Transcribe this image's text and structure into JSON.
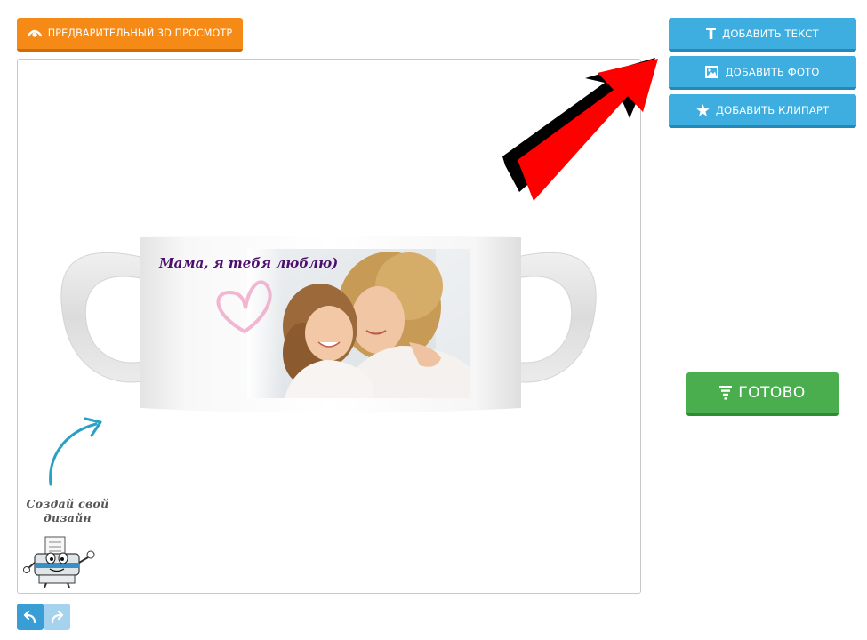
{
  "toolbar": {
    "preview_label": "ПРЕДВАРИТЕЛЬНЫЙ 3D ПРОСМОТР"
  },
  "sidebar": {
    "add_text_label": "ДОБАВИТЬ ТЕКСТ",
    "add_photo_label": "ДОБАВИТЬ ФОТО",
    "add_clipart_label": "ДОБАВИТЬ КЛИПАРТ",
    "ready_label": "ГОТОВО"
  },
  "design": {
    "mug_text": "Мама, я тебя люблю)"
  },
  "hint": {
    "line1": "Создай свой",
    "line2": "дизайн"
  },
  "icons": {
    "preview": "eye-icon",
    "add_text": "text-icon",
    "add_photo": "image-icon",
    "add_clipart": "star-icon",
    "ready": "filter-icon",
    "undo": "undo-icon",
    "redo": "redo-icon"
  },
  "colors": {
    "preview_button": "#f68a17",
    "side_buttons": "#3eaee0",
    "ready_button": "#4aae4e",
    "mug_text": "#4b0f6b",
    "pointer_arrow": "#ff0000"
  }
}
